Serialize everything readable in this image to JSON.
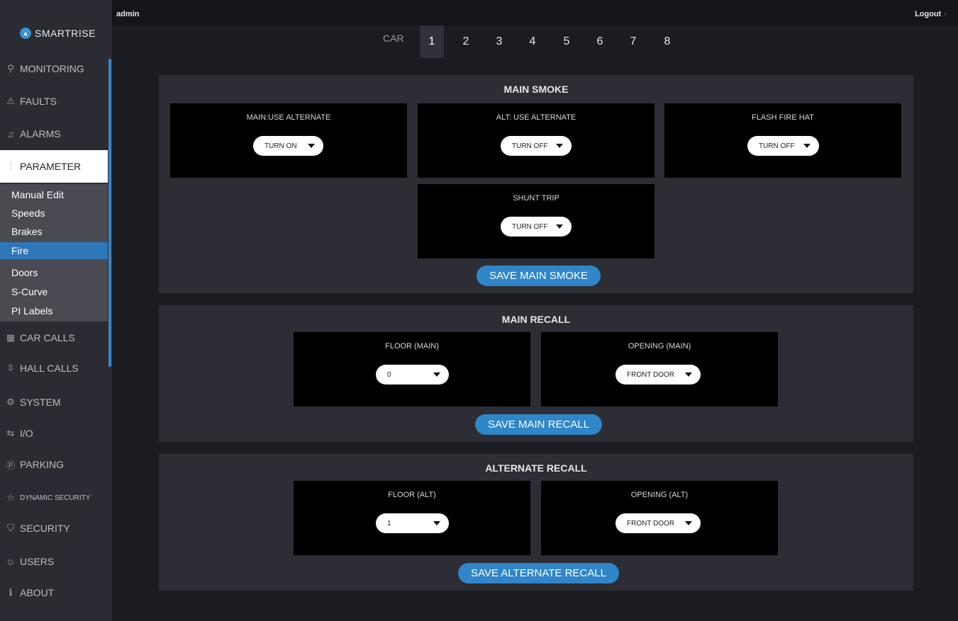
{
  "header": {
    "user": "admin",
    "logout": "Logout"
  },
  "brand": {
    "name": "SMARTRISE"
  },
  "sidebar": {
    "items": [
      {
        "label": "MONITORING",
        "icon": "magnifier-icon"
      },
      {
        "label": "FAULTS",
        "icon": "warning-triangle-icon"
      },
      {
        "label": "ALARMS",
        "icon": "bell-icon"
      },
      {
        "label": "PARAMETER",
        "icon": "sliders-icon"
      },
      {
        "label": "CAR CALLS",
        "icon": "keypad-icon"
      },
      {
        "label": "HALL CALLS",
        "icon": "up-down-arrows-icon"
      },
      {
        "label": "SYSTEM",
        "icon": "gear-icon"
      },
      {
        "label": "I/O",
        "icon": "swap-arrows-icon"
      },
      {
        "label": "PARKING",
        "icon": "parking-icon"
      },
      {
        "label": "DYNAMIC SECURITY",
        "icon": "star-icon"
      },
      {
        "label": "SECURITY",
        "icon": "shield-icon"
      },
      {
        "label": "USERS",
        "icon": "users-icon"
      },
      {
        "label": "ABOUT",
        "icon": "info-icon"
      }
    ],
    "submenu": [
      "Manual Edit",
      "Speeds",
      "Brakes",
      "Fire",
      "Doors",
      "S-Curve",
      "PI Labels"
    ],
    "active_sub": "Fire"
  },
  "cars": {
    "label": "CAR",
    "numbers": [
      "1",
      "2",
      "3",
      "4",
      "5",
      "6",
      "7",
      "8"
    ],
    "active": "1"
  },
  "main_smoke": {
    "title": "MAIN SMOKE",
    "main_use_alt": {
      "label": "MAIN:USE ALTERNATE",
      "value": "TURN ON"
    },
    "alt_use_alt": {
      "label": "ALT: USE ALTERNATE",
      "value": "TURN OFF"
    },
    "flash_fire_hat": {
      "label": "FLASH FIRE HAT",
      "value": "TURN OFF"
    },
    "shunt_trip": {
      "label": "SHUNT TRIP",
      "value": "TURN OFF"
    },
    "save": "SAVE MAIN SMOKE"
  },
  "main_recall": {
    "title": "MAIN RECALL",
    "floor": {
      "label": "FLOOR (MAIN)",
      "value": "0"
    },
    "opening": {
      "label": "OPENING (MAIN)",
      "value": "FRONT DOOR"
    },
    "save": "SAVE MAIN RECALL"
  },
  "alternate_recall": {
    "title": "ALTERNATE RECALL",
    "floor": {
      "label": "FLOOR (ALT)",
      "value": "1"
    },
    "opening": {
      "label": "OPENING (ALT)",
      "value": "FRONT DOOR"
    },
    "save": "SAVE ALTERNATE RECALL"
  },
  "colors": {
    "accent": "#2f86c8",
    "sidebar": "#2b2c33",
    "panel": "#2c2d35",
    "card": "#000000"
  }
}
